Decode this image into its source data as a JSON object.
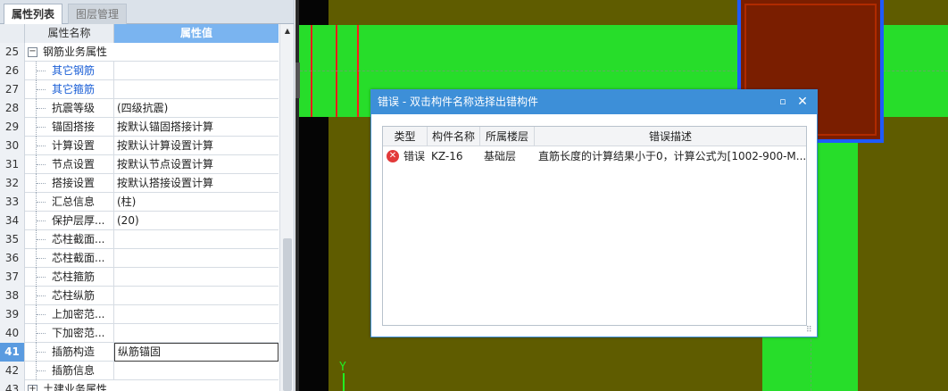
{
  "tabs": {
    "properties": "属性列表",
    "layers": "图层管理"
  },
  "grid": {
    "header_name": "属性名称",
    "header_value": "属性值",
    "rows": [
      {
        "num": "25",
        "name": "钢筋业务属性",
        "value": "",
        "expander": "−"
      },
      {
        "num": "26",
        "name": "其它钢筋",
        "value": ""
      },
      {
        "num": "27",
        "name": "其它箍筋",
        "value": ""
      },
      {
        "num": "28",
        "name": "抗震等级",
        "value": "(四级抗震)"
      },
      {
        "num": "29",
        "name": "锚固搭接",
        "value": "按默认锚固搭接计算"
      },
      {
        "num": "30",
        "name": "计算设置",
        "value": "按默认计算设置计算"
      },
      {
        "num": "31",
        "name": "节点设置",
        "value": "按默认节点设置计算"
      },
      {
        "num": "32",
        "name": "搭接设置",
        "value": "按默认搭接设置计算"
      },
      {
        "num": "33",
        "name": "汇总信息",
        "value": "(柱)"
      },
      {
        "num": "34",
        "name": "保护层厚...",
        "value": "(20)"
      },
      {
        "num": "35",
        "name": "芯柱截面...",
        "value": ""
      },
      {
        "num": "36",
        "name": "芯柱截面...",
        "value": ""
      },
      {
        "num": "37",
        "name": "芯柱箍筋",
        "value": ""
      },
      {
        "num": "38",
        "name": "芯柱纵筋",
        "value": ""
      },
      {
        "num": "39",
        "name": "上加密范...",
        "value": ""
      },
      {
        "num": "40",
        "name": "下加密范...",
        "value": ""
      },
      {
        "num": "41",
        "name": "插筋构造",
        "value": "纵筋锚固"
      },
      {
        "num": "42",
        "name": "插筋信息",
        "value": ""
      },
      {
        "num": "43",
        "name": "土建业务属性",
        "value": "",
        "expander": "+"
      }
    ]
  },
  "viewport": {
    "ucs_label": "Y"
  },
  "dialog": {
    "title": "错误 - 双击构件名称选择出错构件",
    "max_icon": "▫",
    "close_icon": "✕",
    "columns": [
      "类型",
      "构件名称",
      "所属楼层",
      "错误描述"
    ],
    "rows": [
      {
        "type": "错误",
        "component": "KZ-16",
        "floor": "基础层",
        "description": "直筋长度的计算结果小于0，计算公式为[1002-900-M..."
      }
    ]
  },
  "colors": {
    "viewport_bg": "#5f5c00",
    "beam": "#27dd2a",
    "column_fill": "#7a1e00",
    "column_border": "#1e5bff",
    "selected_header": "#7ab4f0",
    "error_icon": "#e23a3a"
  }
}
